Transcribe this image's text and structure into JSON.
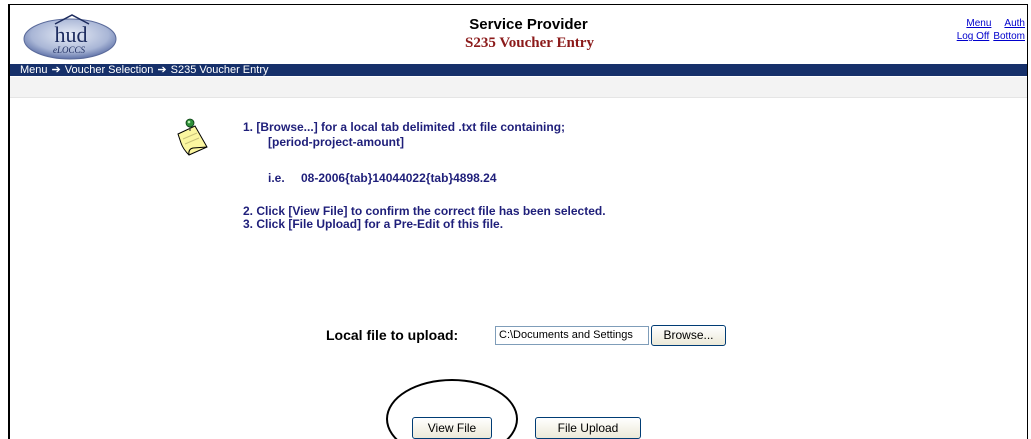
{
  "header": {
    "logo_text": "hud",
    "logo_subtext": "eLOCCS",
    "title": "Service Provider",
    "subtitle": "S235 Voucher Entry",
    "links": {
      "menu": "Menu",
      "auth": "Auth",
      "logoff": "Log Off",
      "bottom": "Bottom"
    }
  },
  "breadcrumb": [
    "Menu",
    "Voucher Selection",
    "S235 Voucher Entry"
  ],
  "instructions": {
    "step1_line1": "1.  [Browse...] for a local tab delimited .txt file containing;",
    "step1_line2": "[period-project-amount]",
    "example_label": "i.e.",
    "example_value": "08-2006{tab}14044022{tab}4898.24",
    "step2": "2.  Click [View File] to confirm the correct file has been selected.",
    "step3": "3.  Click [File Upload] for a Pre-Edit of this file."
  },
  "upload": {
    "label": "Local file to upload:",
    "file_value": "C:\\Documents and Settings",
    "browse_label": "Browse...",
    "view_label": "View File",
    "upload_label": "File Upload"
  },
  "colors": {
    "nav_bg": "#16306a",
    "instruction_text": "#1f1f7a",
    "subtitle": "#8b1a1a"
  }
}
